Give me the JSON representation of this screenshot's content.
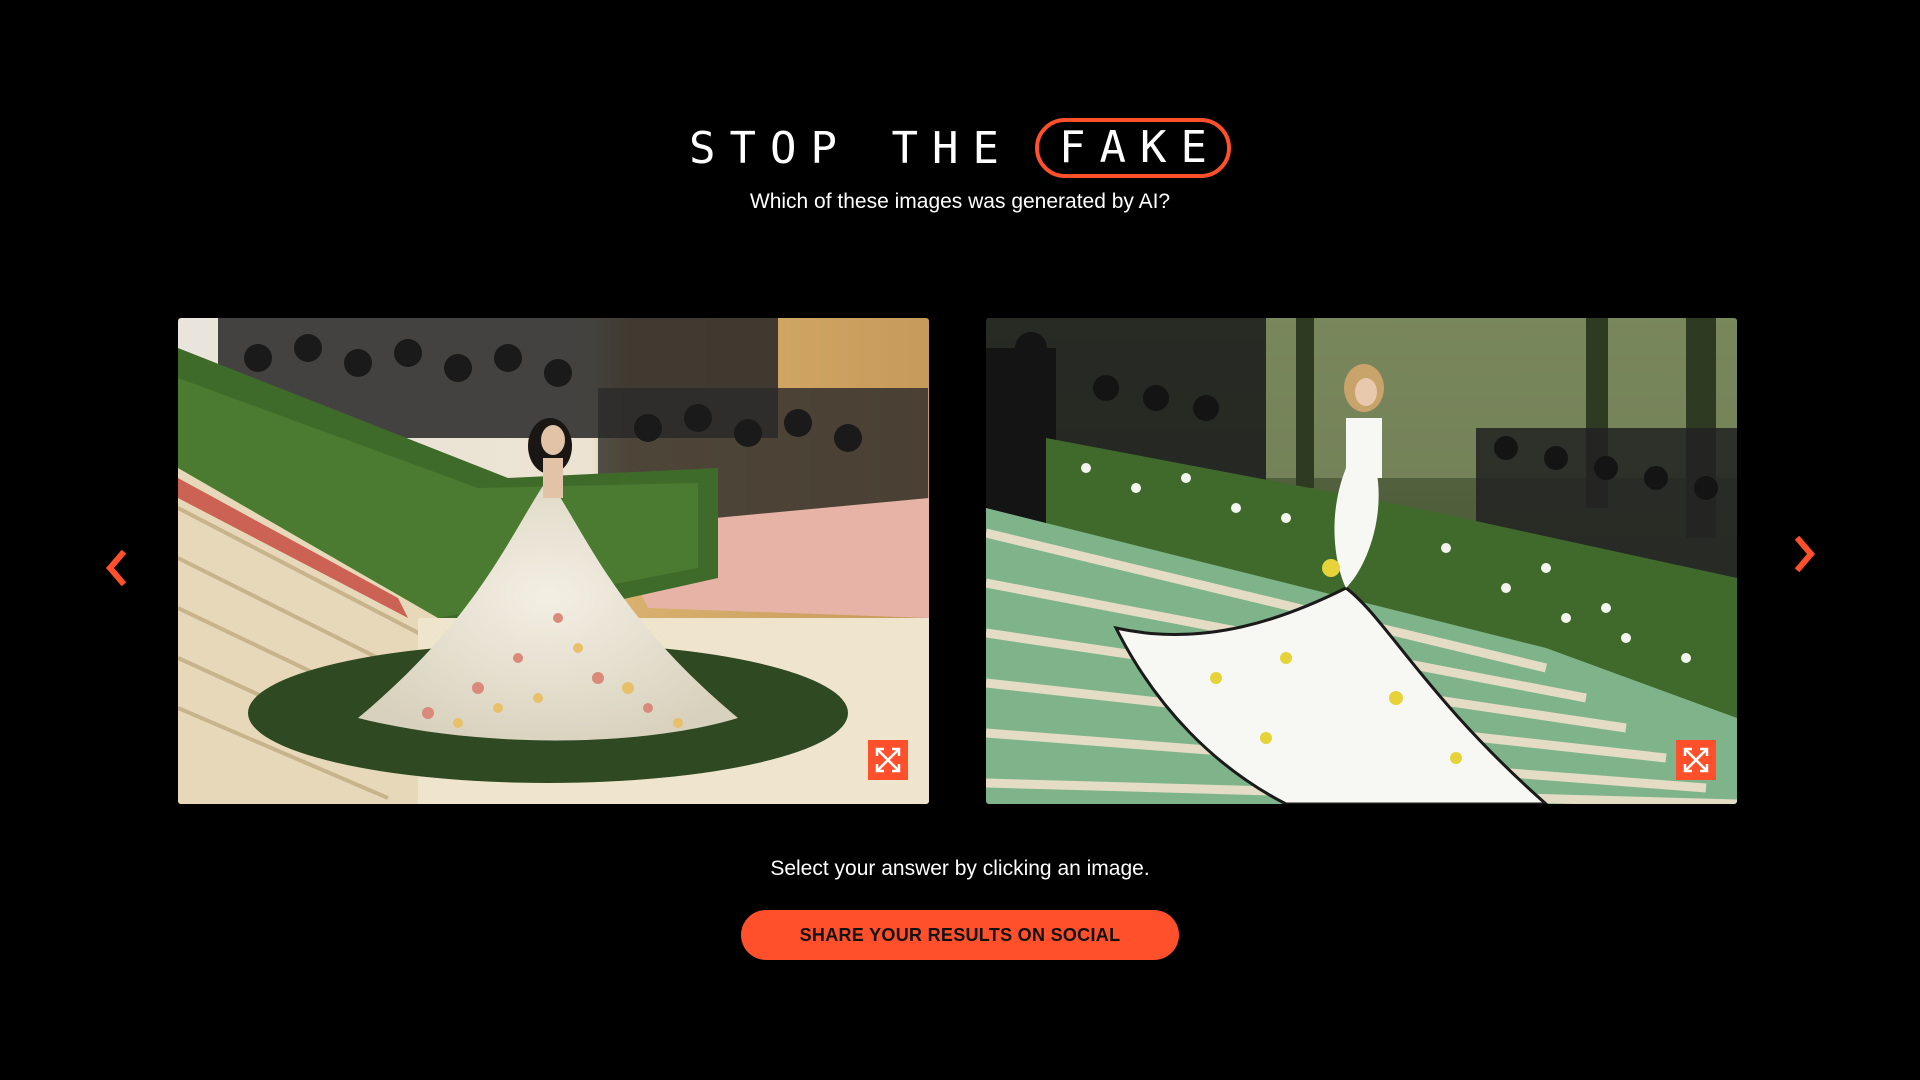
{
  "header": {
    "logo_part1": "STOP THE",
    "logo_part2": "FAKE",
    "subtitle": "Which of these images was generated by AI?"
  },
  "images": [
    {
      "description": "Woman in a floral ball gown on a staircase with photographers",
      "expand_icon": "expand-arrows-icon"
    },
    {
      "description": "Woman in a white gown with yellow flowers on green staircase",
      "expand_icon": "expand-arrows-icon"
    }
  ],
  "nav": {
    "prev_icon": "chevron-left-icon",
    "next_icon": "chevron-right-icon"
  },
  "instruction": "Select your answer by clicking an image.",
  "share_button": "SHARE YOUR RESULTS ON SOCIAL",
  "colors": {
    "accent": "#ff4f2b",
    "background": "#000000",
    "text": "#ffffff"
  }
}
